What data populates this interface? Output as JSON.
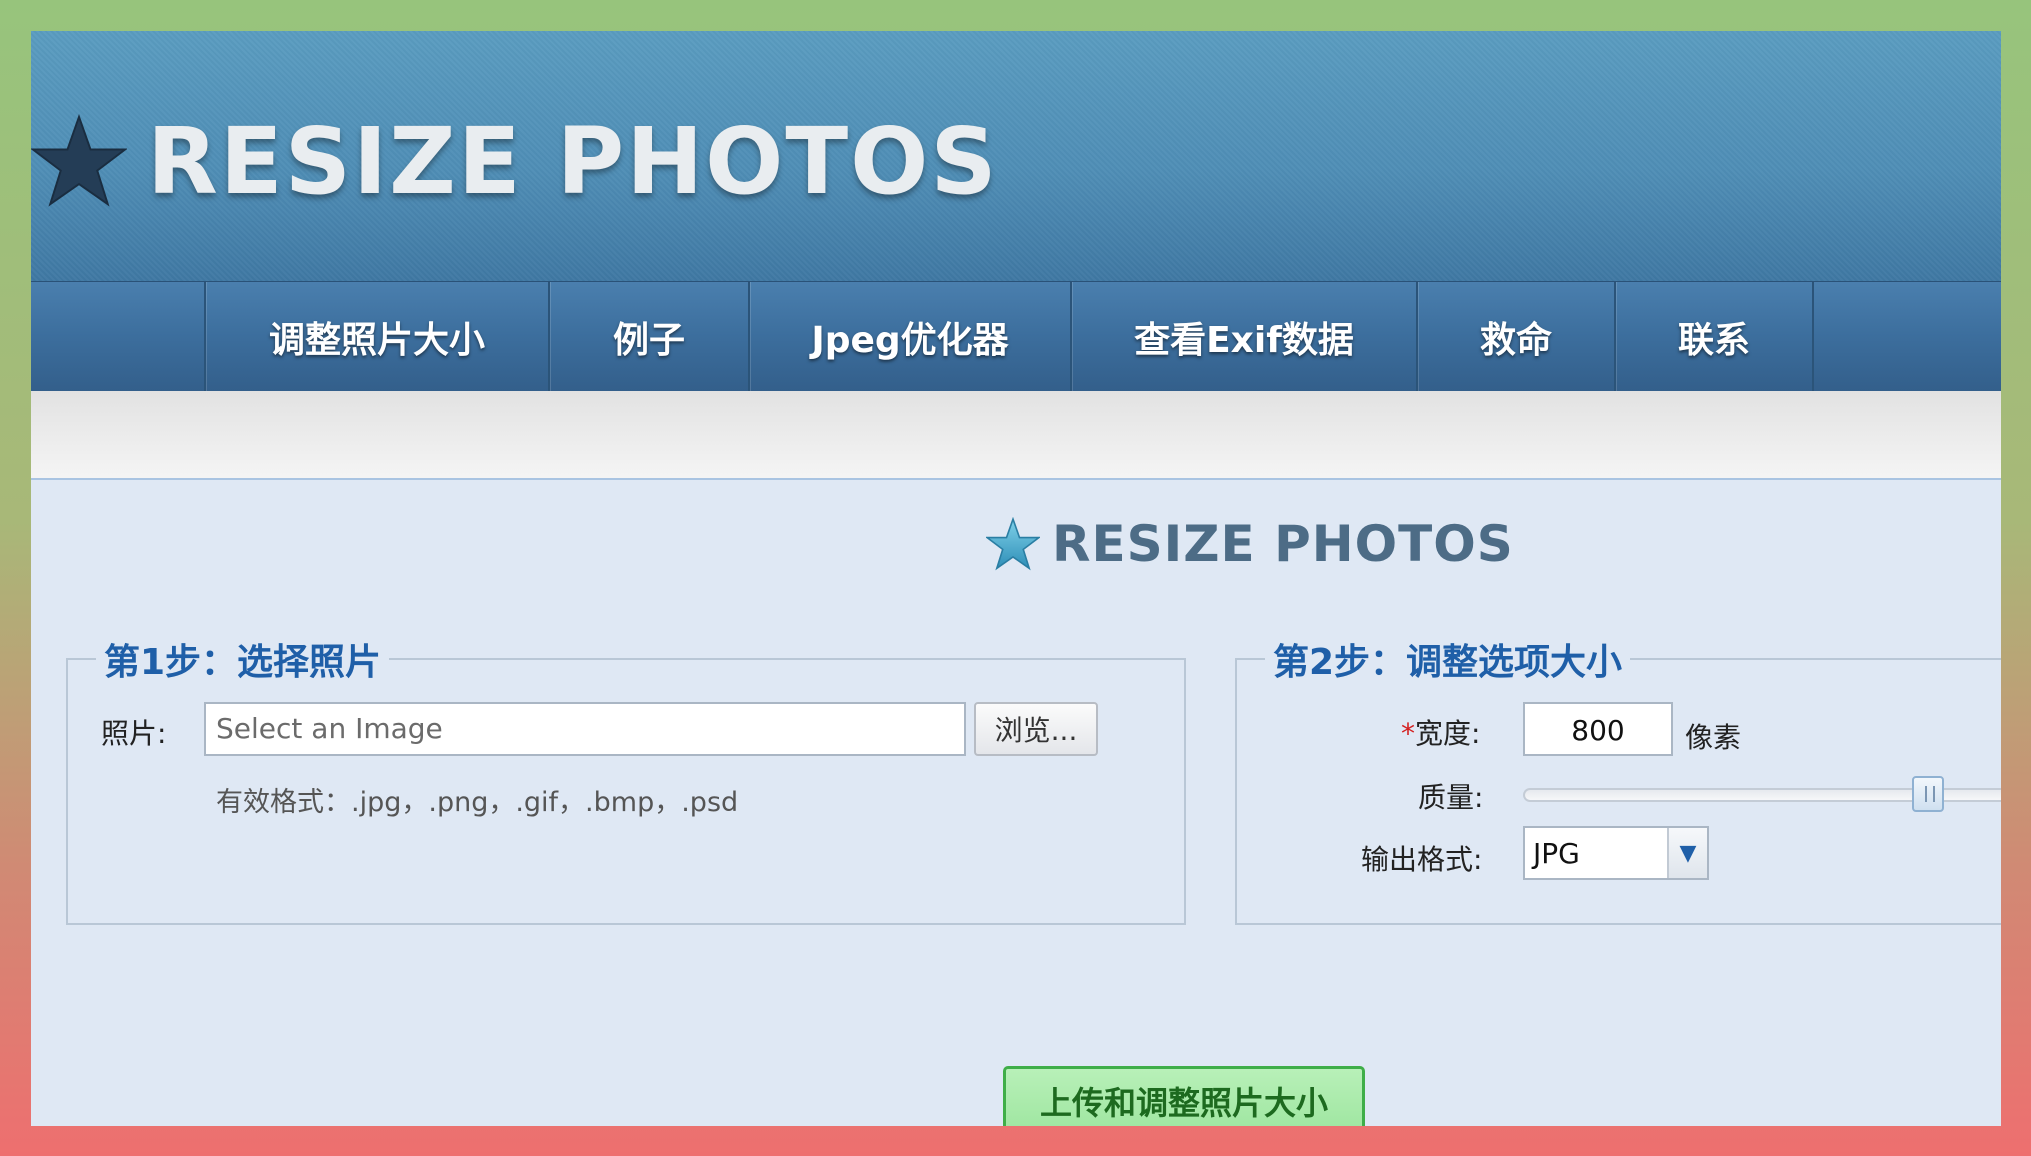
{
  "header": {
    "logo_text": "RESIZE PHOTOS",
    "logo_icon": "star-icon"
  },
  "nav": {
    "items": [
      {
        "label": "调整照片大小"
      },
      {
        "label": "例子"
      },
      {
        "label": "Jpeg优化器"
      },
      {
        "label": "查看Exif数据"
      },
      {
        "label": "救命"
      },
      {
        "label": "联系"
      }
    ]
  },
  "panel": {
    "logo_text": "RESIZE PHOTOS"
  },
  "step1": {
    "legend": "第1步：选择照片",
    "photo_label": "照片:",
    "file_placeholder": "Select an Image",
    "browse_label": "浏览...",
    "formats_hint": "有效格式：.jpg，.png，.gif，.bmp，.psd"
  },
  "step2": {
    "legend": "第2步：调整选项大小",
    "required_mark": "*",
    "width_label": "宽度:",
    "width_value": "800",
    "width_unit": "像素",
    "quality_label": "质量:",
    "quality_level": 0.85,
    "output_label": "输出格式:",
    "output_value": "JPG"
  },
  "submit": {
    "label": "上传和调整照片大小"
  },
  "colors": {
    "accent_blue": "#1f5fa8",
    "submit_green": "#9ee6a0"
  }
}
